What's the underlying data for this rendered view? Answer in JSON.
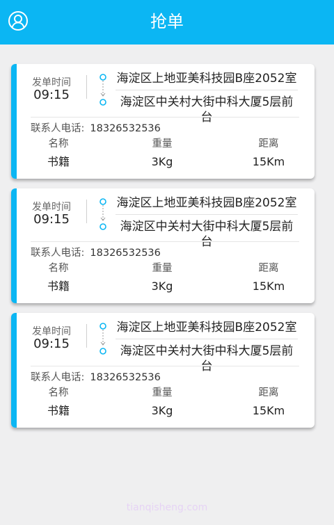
{
  "header": {
    "title": "抢单"
  },
  "orders": [
    {
      "time_label": "发单时间",
      "time": "09:15",
      "from": "海淀区上地亚美科技园B座2052室",
      "to": "海淀区中关村大街中科大厦5层前台",
      "contact_label": "联系人电话:",
      "contact_phone": "18326532536",
      "name_label": "名称",
      "name": "书籍",
      "weight_label": "重量",
      "weight": "3Kg",
      "distance_label": "距离",
      "distance": "15Km"
    },
    {
      "time_label": "发单时间",
      "time": "09:15",
      "from": "海淀区上地亚美科技园B座2052室",
      "to": "海淀区中关村大街中科大厦5层前台",
      "contact_label": "联系人电话:",
      "contact_phone": "18326532536",
      "name_label": "名称",
      "name": "书籍",
      "weight_label": "重量",
      "weight": "3Kg",
      "distance_label": "距离",
      "distance": "15Km"
    },
    {
      "time_label": "发单时间",
      "time": "09:15",
      "from": "海淀区上地亚美科技园B座2052室",
      "to": "海淀区中关村大街中科大厦5层前台",
      "contact_label": "联系人电话:",
      "contact_phone": "18326532536",
      "name_label": "名称",
      "name": "书籍",
      "weight_label": "重量",
      "weight": "3Kg",
      "distance_label": "距离",
      "distance": "15Km"
    }
  ],
  "watermark": "tianqisheng.com",
  "colors": {
    "accent": "#0bb6f3",
    "background": "#efeff0",
    "card": "#ffffff"
  },
  "icons": {
    "user": "user-profile-icon",
    "route": "route-dots-icon"
  }
}
